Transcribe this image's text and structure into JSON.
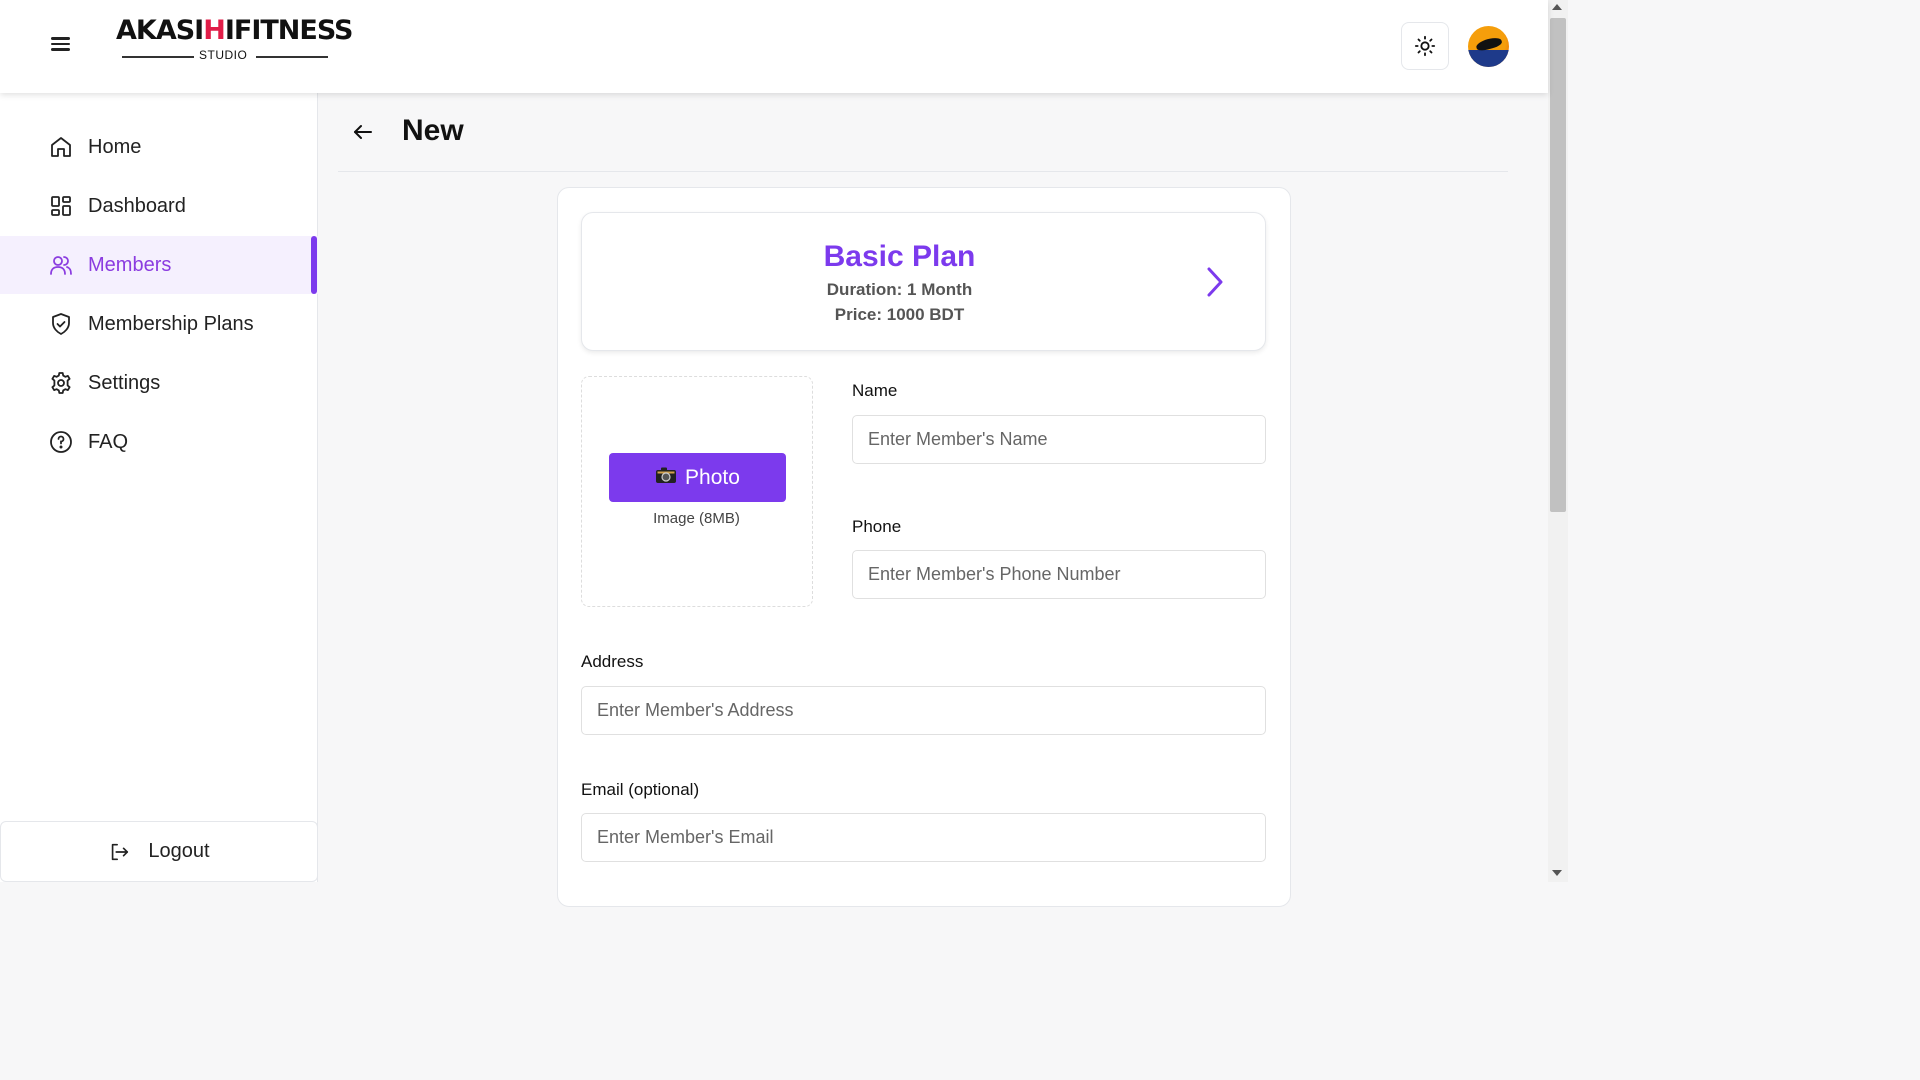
{
  "brand": {
    "logo_main_pre": "AKASI",
    "logo_main_accent": "H",
    "logo_main_post": "IFITNESS",
    "logo_sub": "STUDIO"
  },
  "sidebar": {
    "items": [
      {
        "label": "Home",
        "icon": "home-icon"
      },
      {
        "label": "Dashboard",
        "icon": "dashboard-icon"
      },
      {
        "label": "Members",
        "icon": "users-icon",
        "active": true
      },
      {
        "label": "Membership Plans",
        "icon": "shield-check-icon"
      },
      {
        "label": "Settings",
        "icon": "gear-icon"
      },
      {
        "label": "FAQ",
        "icon": "help-circle-icon"
      }
    ],
    "logout_label": "Logout"
  },
  "page": {
    "title": "New"
  },
  "plan": {
    "name": "Basic Plan",
    "duration": "Duration: 1 Month",
    "price": "Price: 1000 BDT"
  },
  "photo": {
    "button_label": "Photo",
    "hint": "Image (8MB)"
  },
  "form": {
    "name_label": "Name",
    "name_placeholder": "Enter Member's Name",
    "phone_label": "Phone",
    "phone_placeholder": "Enter Member's Phone Number",
    "address_label": "Address",
    "address_placeholder": "Enter Member's Address",
    "email_label": "Email (optional)",
    "email_placeholder": "Enter Member's Email"
  },
  "colors": {
    "accent": "#7c3aed",
    "active_bg": "#f5f0fe",
    "logo_accent": "#e11d48"
  }
}
